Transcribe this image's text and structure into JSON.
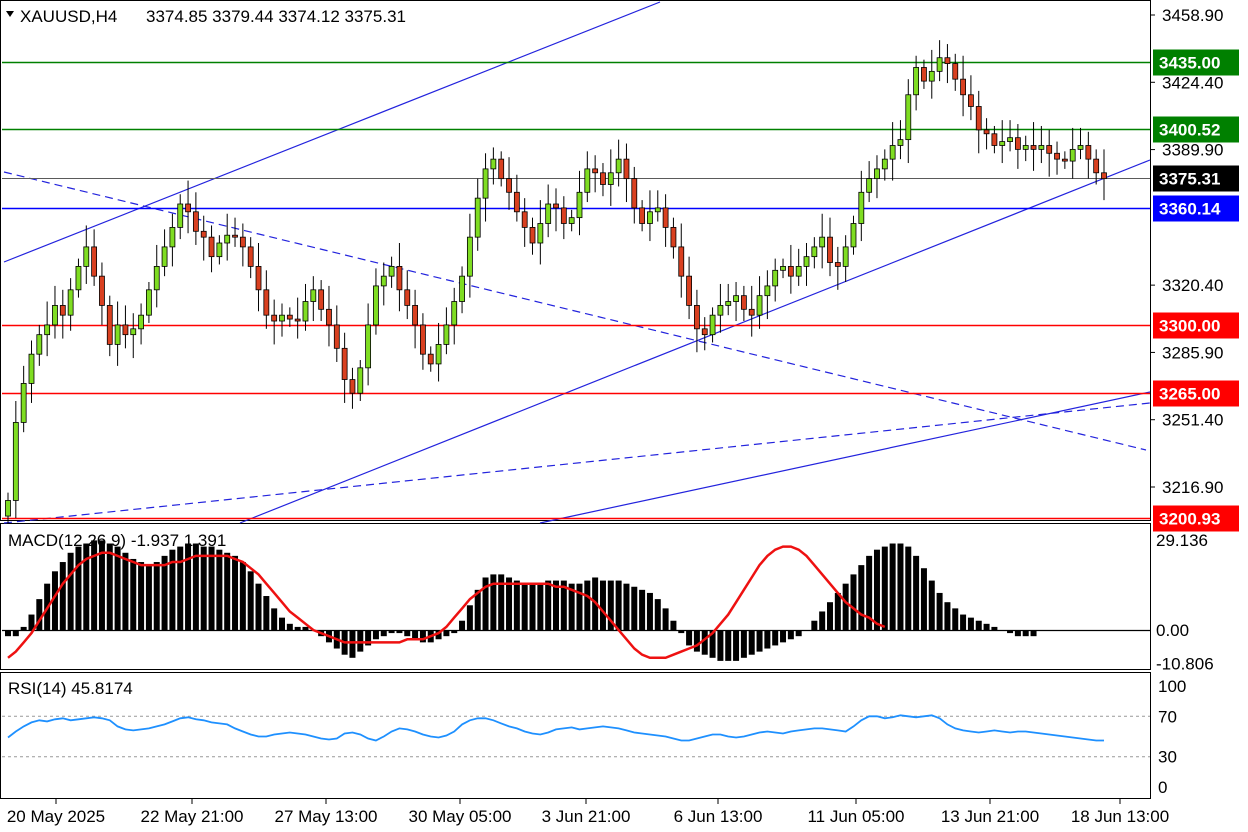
{
  "header": {
    "symbol_timeframe": "XAUUSD,H4",
    "ohlc": "3374.85 3379.44 3374.12 3375.31"
  },
  "chart_data": [
    {
      "type": "candlestick",
      "symbol": "XAUUSD",
      "timeframe": "H4",
      "ylim": [
        3195,
        3465
      ],
      "y_ticks": [
        "3458.90",
        "3424.40",
        "3389.90",
        "3320.40",
        "3285.90",
        "3251.40",
        "3216.90"
      ],
      "x_ticks": [
        "20 May 2025",
        "22 May 21:00",
        "27 May 13:00",
        "30 May 05:00",
        "3 Jun 21:00",
        "6 Jun 13:00",
        "11 Jun 05:00",
        "13 Jun 21:00",
        "18 Jun 13:00"
      ],
      "current_price": "3375.31",
      "horizontal_levels": [
        {
          "label": "3435.00",
          "value": 3435.0,
          "color": "#008000"
        },
        {
          "label": "3400.52",
          "value": 3400.52,
          "color": "#008000"
        },
        {
          "label": "3360.14",
          "value": 3360.14,
          "color": "#0000ff"
        },
        {
          "label": "3300.00",
          "value": 3300.0,
          "color": "#ff0000"
        },
        {
          "label": "3265.00",
          "value": 3265.0,
          "color": "#ff0000"
        },
        {
          "label": "3200.93",
          "value": 3200.93,
          "color": "#ff0000"
        }
      ],
      "closes": [
        3210,
        3250,
        3270,
        3285,
        3295,
        3300,
        3310,
        3305,
        3318,
        3330,
        3340,
        3325,
        3310,
        3290,
        3300,
        3295,
        3298,
        3305,
        3318,
        3330,
        3340,
        3350,
        3362,
        3358,
        3348,
        3345,
        3335,
        3342,
        3346,
        3345,
        3340,
        3330,
        3318,
        3305,
        3302,
        3305,
        3303,
        3302,
        3312,
        3318,
        3308,
        3300,
        3288,
        3272,
        3265,
        3278,
        3300,
        3320,
        3325,
        3330,
        3318,
        3310,
        3300,
        3285,
        3280,
        3290,
        3300,
        3312,
        3325,
        3345,
        3365,
        3380,
        3385,
        3375,
        3368,
        3358,
        3350,
        3342,
        3352,
        3362,
        3360,
        3352,
        3355,
        3368,
        3380,
        3378,
        3372,
        3378,
        3385,
        3375,
        3360,
        3352,
        3358,
        3360,
        3350,
        3340,
        3325,
        3310,
        3298,
        3295,
        3305,
        3310,
        3312,
        3315,
        3308,
        3305,
        3315,
        3320,
        3328,
        3330,
        3325,
        3330,
        3335,
        3340,
        3345,
        3332,
        3330,
        3340,
        3352,
        3368,
        3375,
        3380,
        3385,
        3392,
        3395,
        3418,
        3432,
        3425,
        3430,
        3437,
        3434,
        3426,
        3418,
        3412,
        3400,
        3398,
        3392,
        3394,
        3396,
        3390,
        3392,
        3390,
        3392,
        3388,
        3385,
        3384,
        3390,
        3392,
        3385,
        3378,
        3375
      ]
    },
    {
      "type": "bar+line",
      "indicator": "MACD",
      "label": "MACD(12,26,9) -1.937 1.391",
      "ylim": [
        -14,
        34
      ],
      "y_ticks": [
        "29.136",
        "0.00",
        "-10.806"
      ],
      "main": [
        -2,
        -2,
        1,
        5,
        10,
        15,
        19,
        22,
        25,
        27,
        28,
        29,
        29,
        28,
        27,
        25,
        23,
        22,
        21,
        22,
        24,
        26,
        27,
        28,
        28,
        27,
        27,
        26,
        25,
        24,
        22,
        19,
        15,
        11,
        7,
        4,
        2,
        1,
        1,
        0,
        -2,
        -4,
        -6,
        -8,
        -9,
        -7,
        -5,
        -3,
        -2,
        -1,
        -1,
        -2,
        -3,
        -4,
        -4,
        -3,
        -2,
        -1,
        3,
        8,
        13,
        17,
        18,
        18,
        17,
        16,
        15,
        15,
        15,
        16,
        16,
        16,
        15,
        15,
        16,
        17,
        16,
        16,
        16,
        15,
        14,
        13,
        12,
        10,
        7,
        3,
        -1,
        -5,
        -7,
        -8,
        -9,
        -10,
        -10,
        -10,
        -9,
        -8,
        -7,
        -6,
        -5,
        -4,
        -3,
        -2,
        0,
        3,
        6,
        9,
        12,
        15,
        18,
        21,
        24,
        26,
        27,
        28,
        28,
        27,
        24,
        20,
        16,
        12,
        9,
        7,
        5,
        4,
        3,
        2,
        1,
        0,
        -1,
        -2,
        -2,
        -2
      ],
      "signal": [
        -9,
        -7,
        -4,
        -1,
        3,
        7,
        11,
        15,
        18,
        21,
        23,
        24,
        25,
        25,
        24,
        23,
        22,
        21,
        21,
        21,
        21,
        22,
        22,
        23,
        24,
        24,
        24,
        24,
        24,
        23,
        22,
        20,
        18,
        15,
        12,
        9,
        6,
        4,
        2,
        0,
        -1,
        -2,
        -3,
        -4,
        -4,
        -4,
        -4,
        -4,
        -4,
        -4,
        -4,
        -3,
        -3,
        -3,
        -2,
        -1,
        1,
        4,
        7,
        10,
        12,
        14,
        15,
        15,
        15,
        15,
        15,
        15,
        15,
        15,
        14,
        14,
        13,
        12,
        11,
        9,
        6,
        3,
        0,
        -3,
        -6,
        -8,
        -9,
        -9,
        -9,
        -8,
        -7,
        -6,
        -5,
        -3,
        -1,
        2,
        5,
        9,
        13,
        17,
        21,
        24,
        26,
        27,
        27,
        26,
        24,
        21,
        18,
        15,
        12,
        9,
        7,
        5,
        4,
        2,
        1
      ]
    },
    {
      "type": "line",
      "indicator": "RSI",
      "label": "RSI(14) 45.8174",
      "ylim": [
        0,
        100
      ],
      "y_ticks": [
        "100",
        "70",
        "30",
        "0"
      ],
      "levels": [
        70,
        30
      ],
      "values": [
        49,
        55,
        60,
        64,
        66,
        65,
        67,
        68,
        66,
        67,
        68,
        69,
        68,
        66,
        60,
        57,
        56,
        57,
        58,
        60,
        62,
        65,
        68,
        69,
        67,
        66,
        64,
        63,
        62,
        58,
        55,
        52,
        50,
        50,
        52,
        53,
        54,
        53,
        52,
        50,
        48,
        47,
        48,
        53,
        54,
        52,
        48,
        46,
        50,
        55,
        58,
        57,
        55,
        52,
        50,
        49,
        51,
        55,
        62,
        66,
        68,
        68,
        66,
        63,
        60,
        58,
        55,
        53,
        52,
        54,
        57,
        58,
        59,
        57,
        58,
        59,
        60,
        59,
        58,
        56,
        54,
        53,
        52,
        51,
        50,
        48,
        46,
        46,
        48,
        50,
        52,
        52,
        50,
        49,
        50,
        52,
        54,
        55,
        54,
        53,
        55,
        56,
        57,
        58,
        58,
        57,
        56,
        55,
        60,
        66,
        70,
        70,
        68,
        69,
        71,
        70,
        69,
        70,
        71,
        68,
        62,
        58,
        56,
        55,
        54,
        55,
        56,
        55,
        54,
        55,
        55,
        54,
        53,
        52,
        51,
        50,
        49,
        48,
        47,
        46,
        46
      ]
    }
  ]
}
